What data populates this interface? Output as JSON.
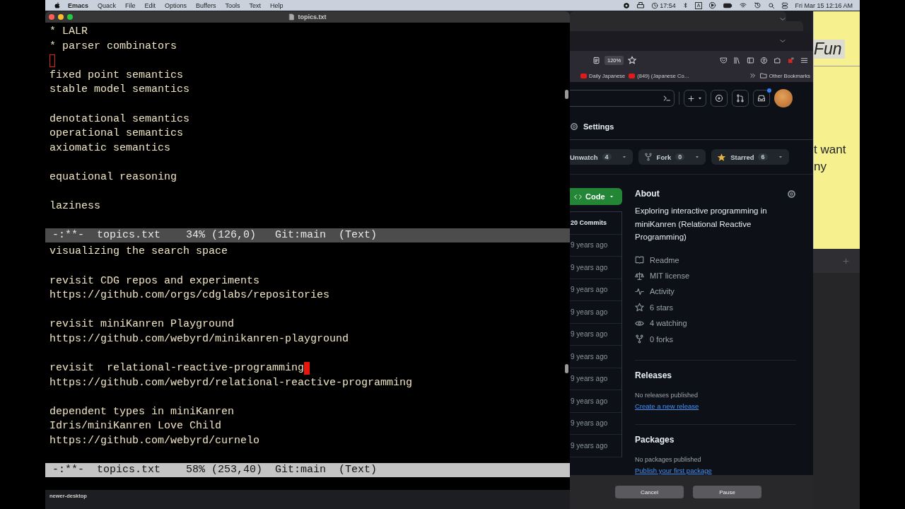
{
  "menubar": {
    "app": "Emacs",
    "menus": [
      "Quack",
      "File",
      "Edit",
      "Options",
      "Buffers",
      "Tools",
      "Text",
      "Help"
    ],
    "timer": "17:54",
    "input_source": "A",
    "datetime": "Fri Mar 15  12:16 AM"
  },
  "emacs": {
    "title": "topics.txt",
    "panes": [
      {
        "paragraphs": [
          {
            "lines": [
              {
                "text": "* LALR"
              },
              {
                "text": "* parser combinators"
              }
            ],
            "cursor": {
              "filled": false
            }
          },
          {
            "lines": [
              {
                "text": "fixed point semantics"
              },
              {
                "text": "stable model semantics"
              }
            ]
          },
          {
            "lines": [
              {
                "text": "denotational semantics"
              },
              {
                "text": "operational semantics"
              },
              {
                "text": "axiomatic semantics"
              }
            ]
          },
          {
            "lines": [
              {
                "text": "equational reasoning"
              }
            ]
          },
          {
            "lines": [
              {
                "text": "laziness"
              }
            ]
          }
        ],
        "mode_line": {
          "text": "-:**-  topics.txt    34% (126,0)   Git:main  (Text)",
          "active": false
        }
      },
      {
        "paragraphs": [
          {
            "lines": [
              {
                "text": "visualizing the search space"
              }
            ]
          },
          {
            "lines": [
              {
                "text": "revisit CDG repos and experiments"
              },
              {
                "text": "https://github.com/orgs/cdglabs/repositories"
              }
            ]
          },
          {
            "lines": [
              {
                "text": "revisit miniKanren Playground"
              },
              {
                "text": "https://github.com/webyrd/minikanren-playground"
              }
            ]
          },
          {
            "lines": [
              {
                "text": "revisit  relational-reactive-programming",
                "cursor": {
                  "filled": true
                }
              },
              {
                "text": "https://github.com/webyrd/relational-reactive-programming"
              }
            ]
          },
          {
            "lines": [
              {
                "text": "dependent types in miniKanren"
              },
              {
                "text": "Idris/miniKanren Love Child"
              },
              {
                "text": "https://github.com/webyrd/curnelo"
              }
            ]
          }
        ],
        "mode_line": {
          "text": "-:**-  topics.txt    58% (253,40)  Git:main  (Text)",
          "active": true
        }
      }
    ]
  },
  "browser": {
    "zoom": "120%",
    "bookmarks": [
      {
        "label": "Daily Japanese"
      },
      {
        "label": "(849) (Japanese Co…"
      }
    ],
    "other_bookmarks": "Other Bookmarks",
    "repo_nav": "Settings",
    "repo_actions": [
      {
        "kind": "watch",
        "label": "Unwatch",
        "count": "4"
      },
      {
        "kind": "fork",
        "label": "Fork",
        "count": "0"
      },
      {
        "kind": "star",
        "label": "Starred",
        "count": "6"
      }
    ],
    "code_button": "Code",
    "commits": "20 Commits",
    "commit_times": [
      "9 years ago",
      "9 years ago",
      "9 years ago",
      "9 years ago",
      "9 years ago",
      "9 years ago",
      "9 years ago",
      "9 years ago",
      "9 years ago",
      "9 years ago"
    ],
    "about": {
      "title": "About",
      "description": "Exploring interactive programming in miniKanren (Relational Reactive Programming)",
      "links": [
        {
          "kind": "book",
          "label": "Readme"
        },
        {
          "kind": "scale",
          "label": "MIT license"
        },
        {
          "kind": "pulse",
          "label": "Activity"
        },
        {
          "kind": "star",
          "label": "6 stars"
        },
        {
          "kind": "eye",
          "label": "4 watching"
        },
        {
          "kind": "fork",
          "label": "0 forks"
        }
      ]
    },
    "sections": [
      {
        "title": "Releases",
        "note": "No releases published",
        "link": "Create a new release"
      },
      {
        "title": "Packages",
        "note": "No packages published",
        "link": "Publish your first package"
      }
    ]
  },
  "sticky_note": {
    "lines": [
      "Fun",
      "t want",
      "ny"
    ]
  },
  "dialog": {
    "buttons": [
      "Cancel",
      "Pause"
    ]
  },
  "desktop": {
    "label": "newer-desktop"
  }
}
